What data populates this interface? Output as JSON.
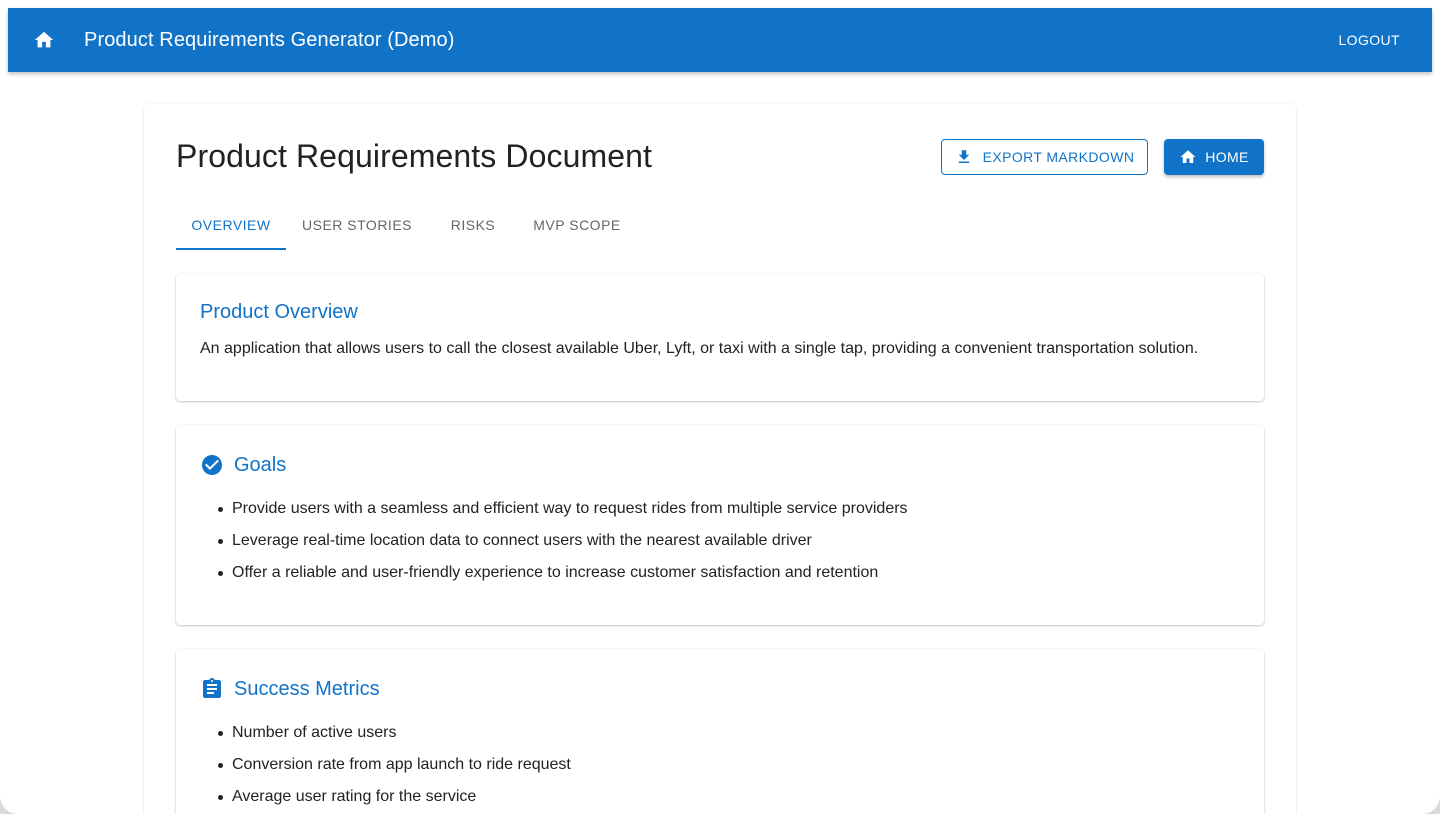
{
  "appbar": {
    "title": "Product Requirements Generator (Demo)",
    "logout_label": "LOGOUT",
    "home_icon": "home-icon",
    "color": "#1173c8"
  },
  "document": {
    "title": "Product Requirements Document",
    "export_label": "EXPORT MARKDOWN",
    "home_label": "HOME"
  },
  "tabs": [
    {
      "label": "OVERVIEW",
      "active": true
    },
    {
      "label": "USER STORIES",
      "active": false
    },
    {
      "label": "RISKS",
      "active": false
    },
    {
      "label": "MVP SCOPE",
      "active": false
    }
  ],
  "overview": {
    "title": "Product Overview",
    "text": "An application that allows users to call the closest available Uber, Lyft, or taxi with a single tap, providing a convenient transportation solution."
  },
  "goals": {
    "title": "Goals",
    "icon": "check-circle-icon",
    "items": [
      "Provide users with a seamless and efficient way to request rides from multiple service providers",
      "Leverage real-time location data to connect users with the nearest available driver",
      "Offer a reliable and user-friendly experience to increase customer satisfaction and retention"
    ]
  },
  "metrics": {
    "title": "Success Metrics",
    "icon": "clipboard-icon",
    "items": [
      "Number of active users",
      "Conversion rate from app launch to ride request",
      "Average user rating for the service"
    ]
  }
}
